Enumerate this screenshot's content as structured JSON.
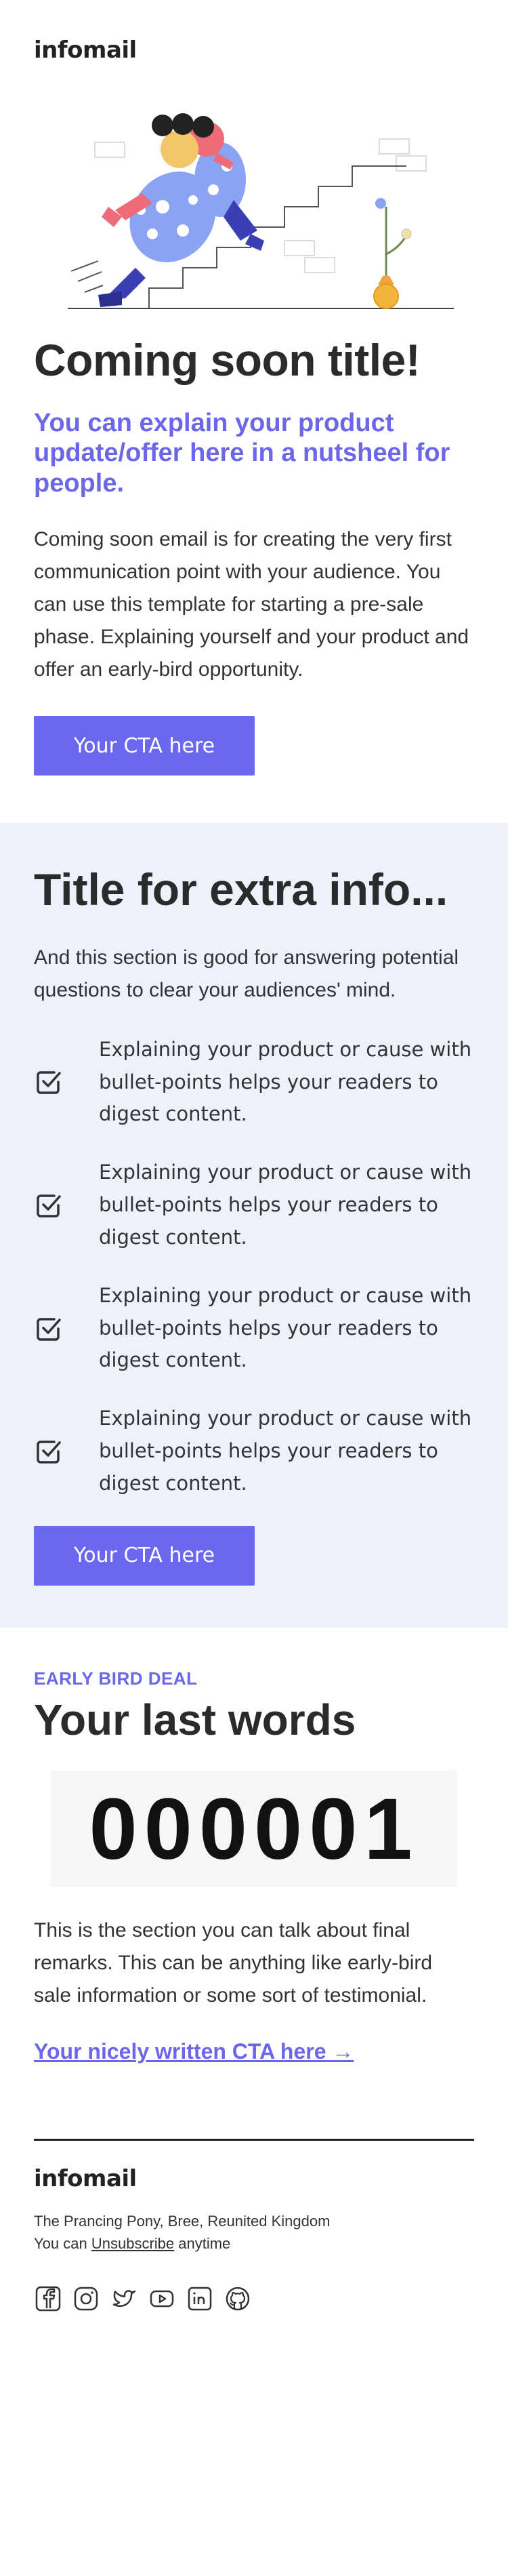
{
  "header": {
    "logo": "infomail"
  },
  "hero": {
    "illustration": "person-climbing-stairs-illustration",
    "title": "Coming soon title!",
    "lead": "You can explain your product update/offer here in a nutsheel for people.",
    "body": "Coming soon email is for creating the very first communication point with your audience. You can use this template for starting a pre-sale phase. Explaining yourself and your product and offer an early-bird opportunity.",
    "cta": "Your CTA here"
  },
  "extra": {
    "title": "Title for extra info...",
    "body": "And this section is good for answering potential questions to clear your audiences' mind.",
    "bullets": [
      "Explaining your product or cause with bullet-points helps your readers to digest content.",
      "Explaining your product or cause with bullet-points helps your readers to digest content.",
      "Explaining your product or cause with bullet-points helps your readers to digest content.",
      "Explaining your product or cause with bullet-points helps your readers to digest content."
    ],
    "bullet_icon": "checkbox-icon",
    "cta": "Your CTA here"
  },
  "final": {
    "eyebrow": "EARLY BIRD DEAL",
    "title": "Your last words",
    "code": "000001",
    "body": "This is the section you can talk about final remarks. This can be anything like early-bird sale information or some sort of testimonial.",
    "link": "Your nicely written CTA here →"
  },
  "footer": {
    "logo": "infomail",
    "address": "The Prancing Pony, Bree, Reunited Kingdom",
    "unsub_prefix": "You can",
    "unsub_link": "Unsubscribe",
    "unsub_suffix": "anytime",
    "socials": [
      "facebook-icon",
      "instagram-icon",
      "twitter-icon",
      "youtube-icon",
      "linkedin-icon",
      "github-icon"
    ]
  },
  "colors": {
    "accent": "#6b67ef",
    "section_bg": "#eef0fc",
    "text": "#2d2d2d"
  }
}
